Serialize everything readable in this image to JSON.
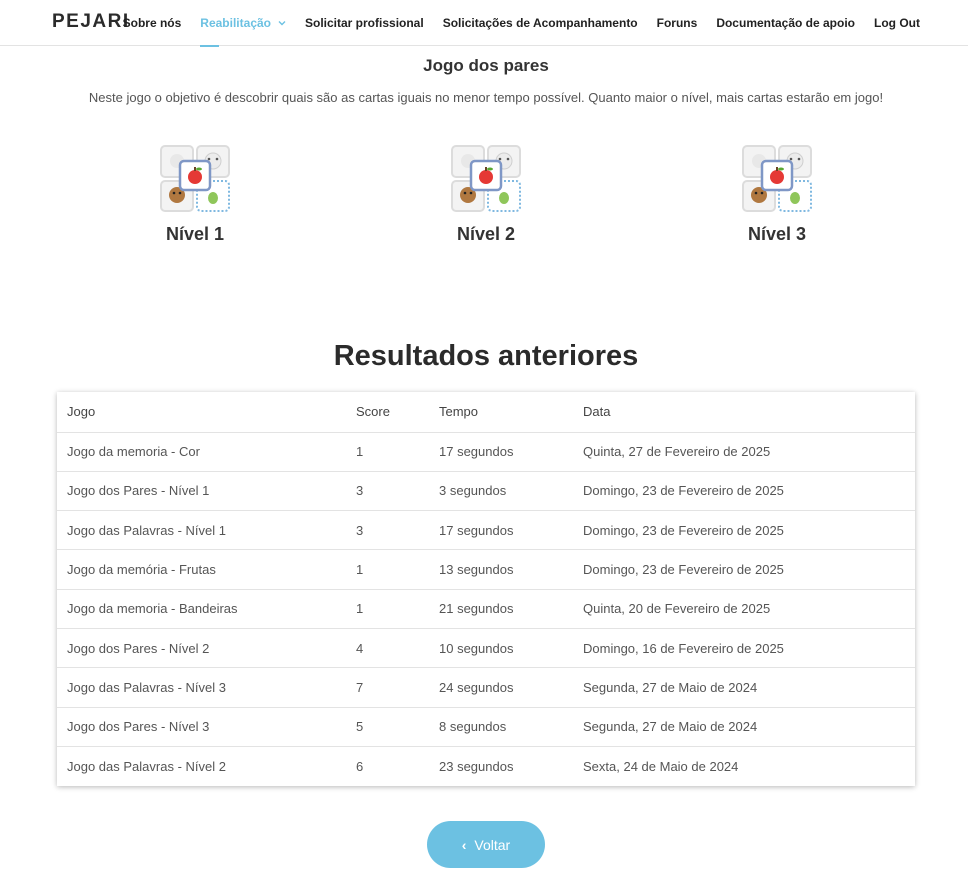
{
  "header": {
    "logo": "PEJARI",
    "nav": [
      {
        "label": "Sobre nós",
        "active": false
      },
      {
        "label": "Reabilitação",
        "active": true
      },
      {
        "label": "Solicitar profissional",
        "active": false
      },
      {
        "label": "Solicitações de Acompanhamento",
        "active": false
      },
      {
        "label": "Foruns",
        "active": false
      },
      {
        "label": "Documentação de apoio",
        "active": false
      },
      {
        "label": "Log Out",
        "active": false
      }
    ]
  },
  "game": {
    "title": "Jogo dos pares",
    "description": "Neste jogo o objetivo é descobrir quais são as cartas iguais no menor tempo possível. Quanto maior o nível, mais cartas estarão em jogo!",
    "levels": [
      {
        "label": "Nível 1",
        "icon": "cards-icon"
      },
      {
        "label": "Nível 2",
        "icon": "cards-icon"
      },
      {
        "label": "Nível 3",
        "icon": "cards-icon"
      }
    ]
  },
  "results": {
    "title": "Resultados anteriores",
    "columns": [
      "Jogo",
      "Score",
      "Tempo",
      "Data"
    ],
    "rows": [
      [
        "Jogo da memoria - Cor",
        "1",
        "17 segundos",
        "Quinta, 27 de Fevereiro de 2025"
      ],
      [
        "Jogo dos Pares - Nível 1",
        "3",
        "3 segundos",
        "Domingo, 23 de Fevereiro de 2025"
      ],
      [
        "Jogo das Palavras - Nível 1",
        "3",
        "17 segundos",
        "Domingo, 23 de Fevereiro de 2025"
      ],
      [
        "Jogo da memória - Frutas",
        "1",
        "13 segundos",
        "Domingo, 23 de Fevereiro de 2025"
      ],
      [
        "Jogo da memoria - Bandeiras",
        "1",
        "21 segundos",
        "Quinta, 20 de Fevereiro de 2025"
      ],
      [
        "Jogo dos Pares - Nível 2",
        "4",
        "10 segundos",
        "Domingo, 16 de Fevereiro de 2025"
      ],
      [
        "Jogo das Palavras - Nível 3",
        "7",
        "24 segundos",
        "Segunda, 27 de Maio de 2024"
      ],
      [
        "Jogo dos Pares - Nível 3",
        "5",
        "8 segundos",
        "Segunda, 27 de Maio de 2024"
      ],
      [
        "Jogo das Palavras - Nível 2",
        "6",
        "23 segundos",
        "Sexta, 24 de Maio de 2024"
      ]
    ]
  },
  "back_button": {
    "label": "Voltar",
    "icon": "chevron-left-icon"
  },
  "colors": {
    "accent": "#6cc1e2",
    "text": "#333333"
  }
}
